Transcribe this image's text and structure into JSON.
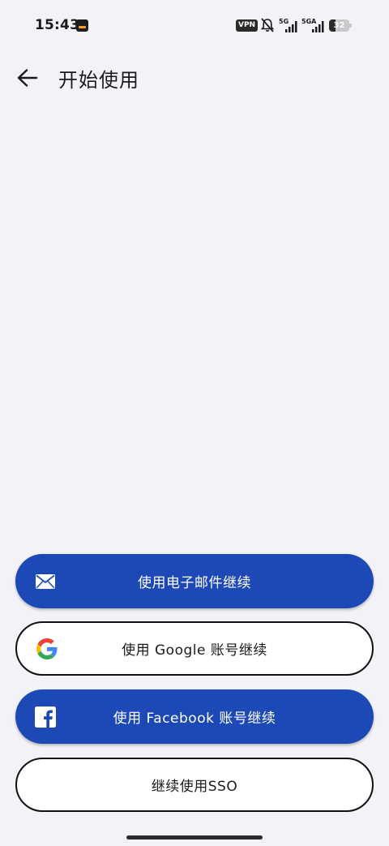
{
  "status_bar": {
    "time": "15:43",
    "vpn": "VPN",
    "network_1": "5G",
    "network_2": "5GA",
    "battery": "32",
    "battery_level": 0.32
  },
  "header": {
    "title": "开始使用",
    "back_icon": "arrow-left-icon"
  },
  "auth_options": {
    "email": {
      "label": "使用电子邮件继续",
      "icon": "mail-icon"
    },
    "google": {
      "label": "使用 Google 账号继续",
      "icon": "google-icon"
    },
    "facebook": {
      "label": "使用 Facebook 账号继续",
      "icon": "facebook-icon"
    },
    "sso": {
      "label": "继续使用SSO"
    }
  },
  "colors": {
    "primary": "#1d49b6",
    "background": "#f3f2f7",
    "outline": "#111111"
  }
}
